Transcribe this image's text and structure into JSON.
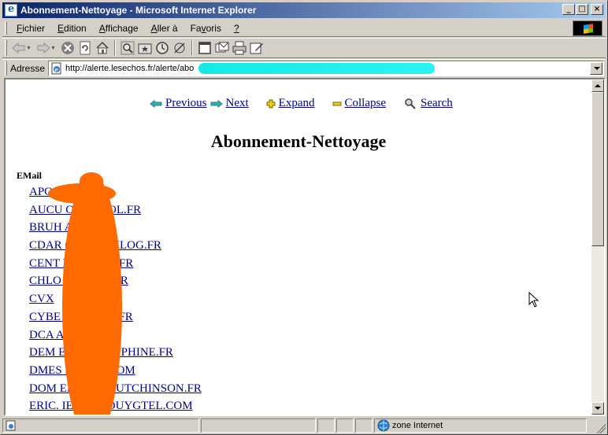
{
  "window": {
    "title": "Abonnement-Nettoyage - Microsoft Internet Explorer",
    "controls": [
      "_",
      "□",
      "×"
    ]
  },
  "menubar": {
    "items": [
      {
        "label": "Fichier",
        "accel": "F",
        "rest": "ichier"
      },
      {
        "label": "Edition",
        "accel": "E",
        "rest": "dition"
      },
      {
        "label": "Affichage",
        "accel": "A",
        "rest": "ffichage"
      },
      {
        "label": "Aller à",
        "accel": "A",
        "rest": "ller à"
      },
      {
        "label": "Favoris",
        "accel": "Fa",
        "rest": "voris",
        "pre": "Fa",
        "u": "v",
        "post": "oris"
      },
      {
        "label": "?",
        "accel": "?",
        "rest": ""
      }
    ]
  },
  "toolbar": {
    "icons": [
      "back-icon",
      "forward-icon",
      "stop-icon",
      "refresh-icon",
      "home-icon",
      "search-icon",
      "favorites-icon",
      "history-icon",
      "channels-icon",
      "fullscreen-icon",
      "mail-icon",
      "print-icon",
      "edit-icon"
    ]
  },
  "address": {
    "label": "Adresse",
    "url": "http://alerte.lesechos.fr/alerte/abo"
  },
  "page": {
    "nav": {
      "previous": "Previous",
      "next": "Next",
      "expand": "Expand",
      "collapse": "Collapse",
      "search": "Search"
    },
    "title": "Abonnement-Nettoyage",
    "email_label": "EMail",
    "emails": [
      "APO           SEBUD.FR",
      "AUCU          ORT@AOL.FR",
      "BRUH          AOL.FR",
      "CDAR          OUSE.UNILOG.FR",
      "CENT          NIORT.CC.FR",
      "CHLO          CHELLO.FR",
      "CVX",
      "CYBE          NET.CLIC.FR",
      "DCA           AOL.FR",
      "DEM           EDIA9.DAUPHINE.FR",
      "DMES          N-SOFT.COM",
      "DOM           ELLOS@HUTCHINSON.FR",
      "ERIC.         IERE@BOUYGTEL.COM"
    ]
  },
  "status": {
    "zone": "zone Internet"
  },
  "colors": {
    "titlebar_start": "#0a246a",
    "titlebar_end": "#a6caf0",
    "link": "#00008b",
    "redaction_orange": "#ff6a00",
    "redaction_cyan": "#16e8e8"
  }
}
